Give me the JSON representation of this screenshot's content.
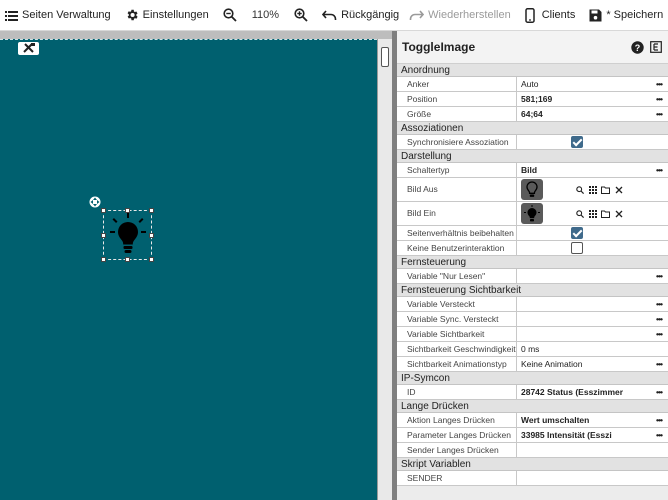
{
  "toolbar": {
    "pages_label": "Seiten Verwaltung",
    "settings_label": "Einstellungen",
    "zoom_value": "110%",
    "undo_label": "Rückgängig",
    "redo_label": "Wiederherstellen",
    "clients_label": "Clients",
    "save_label": "* Speichern"
  },
  "panel": {
    "title": "ToggleImage",
    "help_icon": "question-circle-icon",
    "expand_icon": "e-box-icon",
    "sections": {
      "anordnung": "Anordnung",
      "assoziationen": "Assoziationen",
      "darstellung": "Darstellung",
      "fernsteuerung": "Fernsteuerung",
      "fernsteuerung_sichtbarkeit": "Fernsteuerung Sichtbarkeit",
      "ipsymcon": "IP-Symcon",
      "lange_druecken": "Lange Drücken",
      "skript_variablen": "Skript Variablen"
    },
    "rows": {
      "anker": {
        "label": "Anker",
        "value": "Auto"
      },
      "position": {
        "label": "Position",
        "value": "581;169"
      },
      "groesse": {
        "label": "Größe",
        "value": "64;64"
      },
      "sync_assoz": {
        "label": "Synchronisiere Assoziation",
        "checked": true
      },
      "schaltertyp": {
        "label": "Schaltertyp",
        "value": "Bild"
      },
      "bild_aus": {
        "label": "Bild Aus"
      },
      "bild_ein": {
        "label": "Bild Ein"
      },
      "seitenverhaeltnis": {
        "label": "Seitenverhältnis beibehalten",
        "checked": true
      },
      "keine_interaktion": {
        "label": "Keine Benutzerinteraktion",
        "checked": false
      },
      "nur_lesen": {
        "label": "Variable \"Nur Lesen\"",
        "value": ""
      },
      "var_versteckt": {
        "label": "Variable Versteckt",
        "value": ""
      },
      "var_sync_versteckt": {
        "label": "Variable Sync. Versteckt",
        "value": ""
      },
      "var_sichtbarkeit": {
        "label": "Variable Sichtbarkeit",
        "value": ""
      },
      "sicht_geschw": {
        "label": "Sichtbarkeit Geschwindigkeit",
        "value": "0 ms"
      },
      "sicht_anim": {
        "label": "Sichtbarkeit Animationstyp",
        "value": "Keine Animation"
      },
      "id": {
        "label": "ID",
        "value": "28742 Status (Esszimmer"
      },
      "aktion_lang": {
        "label": "Aktion Langes Drücken",
        "value": "Wert umschalten"
      },
      "param_lang": {
        "label": "Parameter Langes Drücken",
        "value": "33985 Intensität (Esszi"
      },
      "sender_lang": {
        "label": "Sender Langes Drücken",
        "value": ""
      },
      "sender": {
        "label": "SENDER",
        "value": ""
      }
    }
  }
}
